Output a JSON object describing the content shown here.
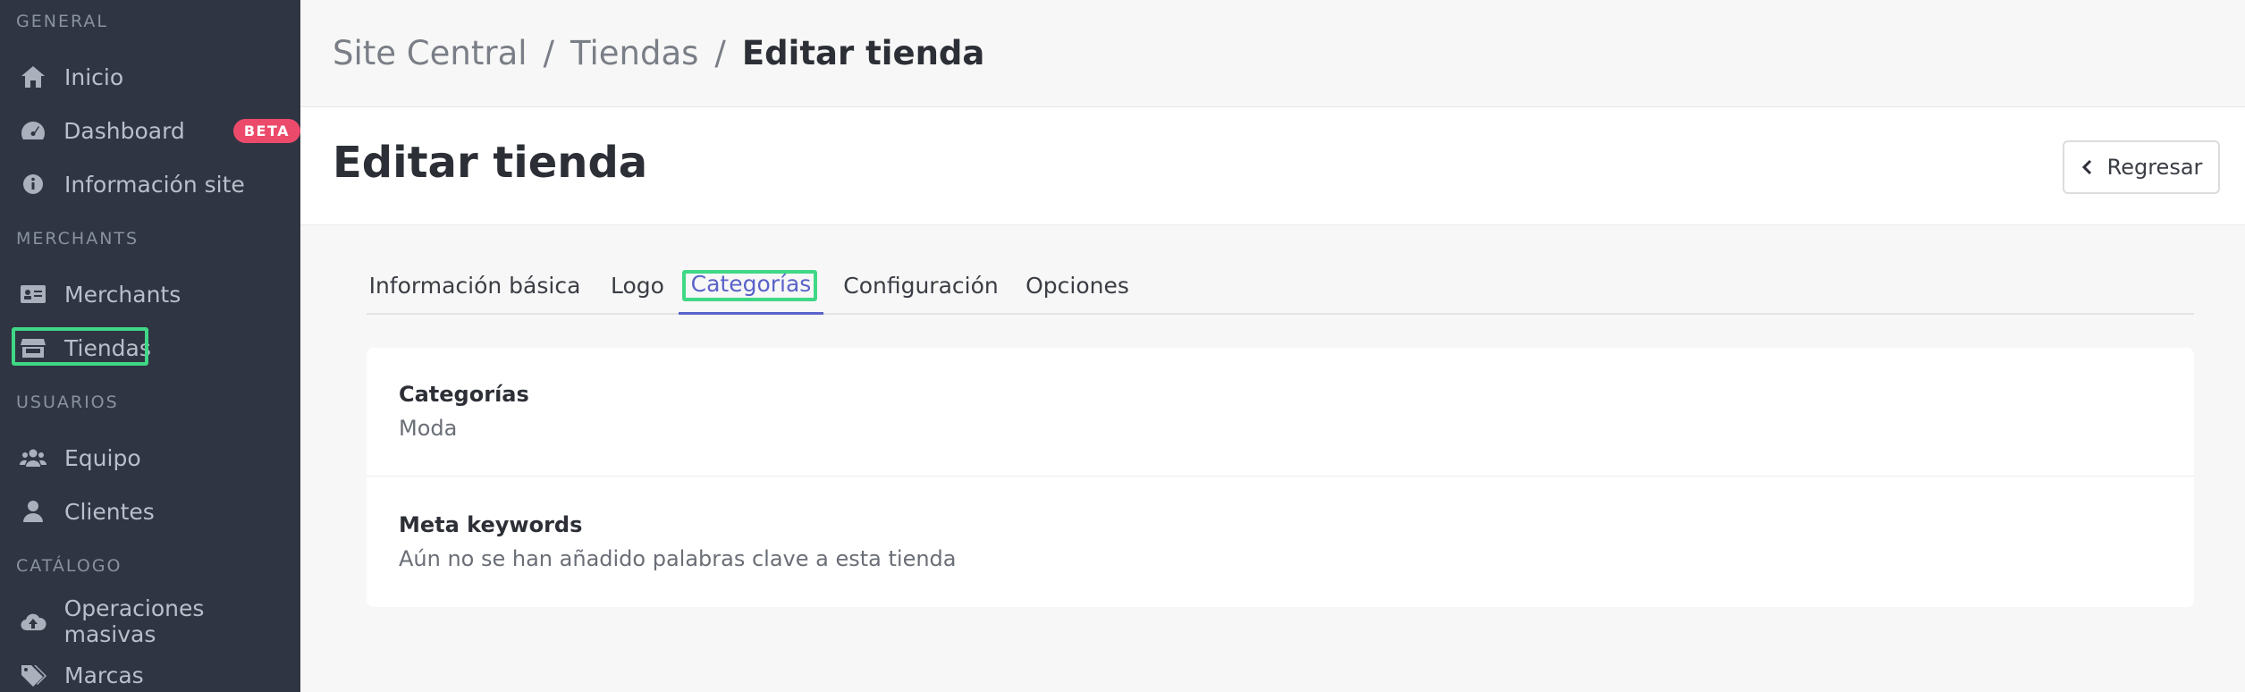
{
  "sidebar": {
    "sections": {
      "general": "GENERAL",
      "merchants": "MERCHANTS",
      "usuarios": "USUARIOS",
      "catalogo": "CATÁLOGO"
    },
    "items": [
      {
        "label": "Inicio",
        "icon": "home-icon"
      },
      {
        "label": "Dashboard",
        "icon": "speedometer-icon",
        "badge": "BETA"
      },
      {
        "label": "Información site",
        "icon": "info-circle-icon"
      },
      {
        "label": "Merchants",
        "icon": "id-card-icon"
      },
      {
        "label": "Tiendas",
        "icon": "store-icon"
      },
      {
        "label": "Equipo",
        "icon": "users-icon"
      },
      {
        "label": "Clientes",
        "icon": "user-icon"
      },
      {
        "label": "Operaciones masivas",
        "icon": "cloud-upload-icon"
      },
      {
        "label": "Marcas",
        "icon": "tags-icon"
      }
    ],
    "badge_color": "#ec4a6b",
    "highlight_color": "#3fd886"
  },
  "breadcrumb": {
    "items": [
      "Site Central",
      "Tiendas"
    ],
    "separator": "/",
    "current": "Editar tienda"
  },
  "header": {
    "title": "Editar tienda",
    "back_label": "Regresar"
  },
  "tabs": [
    {
      "label": "Información básica"
    },
    {
      "label": "Logo"
    },
    {
      "label": "Categorías",
      "active": true
    },
    {
      "label": "Configuración"
    },
    {
      "label": "Opciones"
    }
  ],
  "card": {
    "categories_label": "Categorías",
    "categories_value": "Moda",
    "keywords_label": "Meta keywords",
    "keywords_value": "Aún no se han añadido palabras clave a esta tienda"
  },
  "accent_color": "#5a63c8"
}
